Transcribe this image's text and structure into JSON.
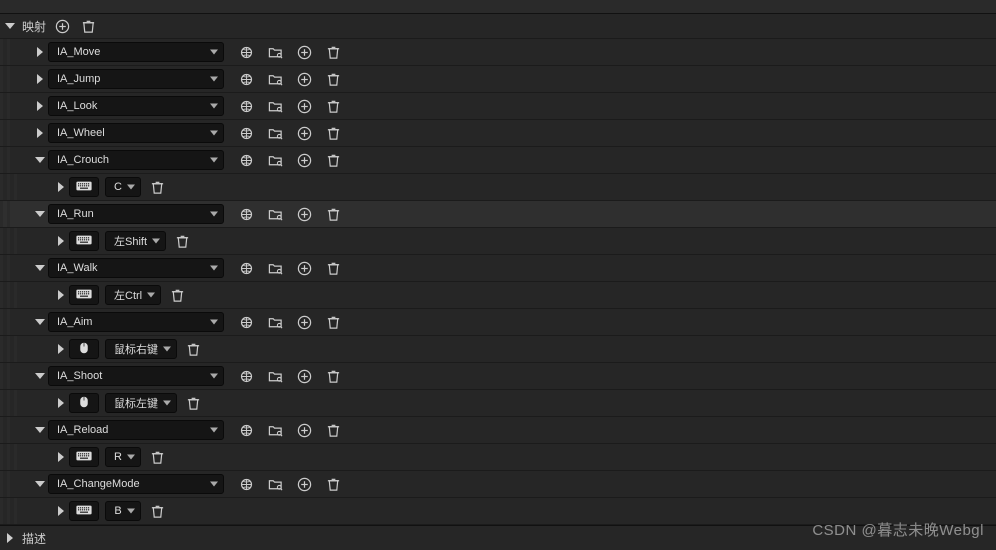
{
  "sections": {
    "header_top": "",
    "mappings_label": "映射",
    "description_label": "描述"
  },
  "actions": [
    {
      "name": "IA_Move",
      "expanded": false,
      "highlight": false
    },
    {
      "name": "IA_Jump",
      "expanded": false,
      "highlight": false
    },
    {
      "name": "IA_Look",
      "expanded": false,
      "highlight": false
    },
    {
      "name": "IA_Wheel",
      "expanded": false,
      "highlight": false
    },
    {
      "name": "IA_Crouch",
      "expanded": true,
      "highlight": false,
      "bindings": [
        {
          "device": "keyboard",
          "key": "C"
        }
      ]
    },
    {
      "name": "IA_Run",
      "expanded": true,
      "highlight": true,
      "bindings": [
        {
          "device": "keyboard",
          "key": "左Shift"
        }
      ]
    },
    {
      "name": "IA_Walk",
      "expanded": true,
      "highlight": false,
      "bindings": [
        {
          "device": "keyboard",
          "key": "左Ctrl"
        }
      ]
    },
    {
      "name": "IA_Aim",
      "expanded": true,
      "highlight": false,
      "bindings": [
        {
          "device": "mouse",
          "key": "鼠标右键"
        }
      ]
    },
    {
      "name": "IA_Shoot",
      "expanded": true,
      "highlight": false,
      "bindings": [
        {
          "device": "mouse",
          "key": "鼠标左键"
        }
      ]
    },
    {
      "name": "IA_Reload",
      "expanded": true,
      "highlight": false,
      "bindings": [
        {
          "device": "keyboard",
          "key": "R"
        }
      ]
    },
    {
      "name": "IA_ChangeMode",
      "expanded": true,
      "highlight": false,
      "bindings": [
        {
          "device": "keyboard",
          "key": "B"
        }
      ]
    }
  ],
  "watermark": "CSDN @暮志未晚Webgl"
}
